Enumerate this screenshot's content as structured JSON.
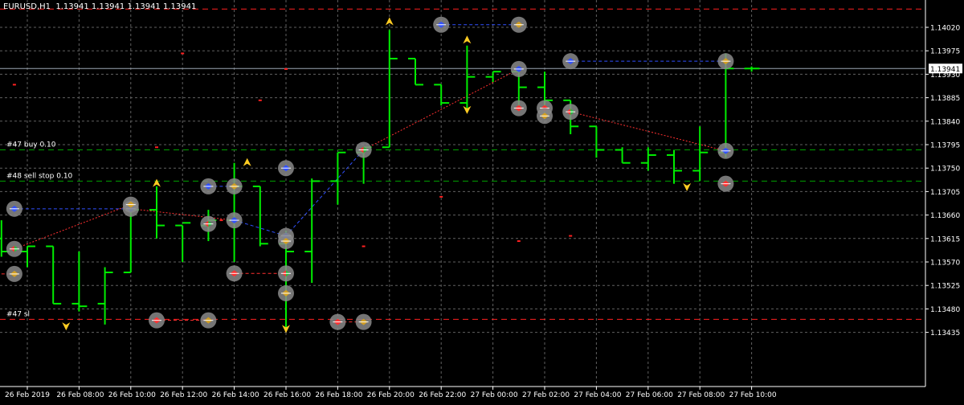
{
  "window": {
    "symbol": "EURUSD,H1",
    "ohlc": "1.13941 1.13941 1.13941 1.13941"
  },
  "colors": {
    "background": "#000000",
    "grid": "#606060",
    "candle": "#00ee00",
    "axis_text": "#ffffff",
    "price_label_bg": "#ffffff",
    "price_label_text": "#000000",
    "bid_line": "#9aa6b3",
    "buy_line": "#00a000",
    "sell_stop_line": "#00a000",
    "sl_line": "#ff2020",
    "trade_buy": "#3050ff",
    "trade_sell": "#ff3030",
    "fractal": "#ffcc22"
  },
  "chart_data": {
    "type": "bar",
    "symbol": "EURUSD",
    "timeframe": "H1",
    "ylim": [
      1.1341,
      1.1406
    ],
    "y_ticks": [
      "1.14020",
      "1.13975",
      "1.13930",
      "1.13885",
      "1.13840",
      "1.13795",
      "1.13750",
      "1.13705",
      "1.13660",
      "1.13615",
      "1.13570",
      "1.13525",
      "1.13480",
      "1.13435"
    ],
    "x_ticks": [
      {
        "i": 0,
        "label": "26 Feb 2019"
      },
      {
        "i": 2,
        "label": "26 Feb 08:00"
      },
      {
        "i": 4,
        "label": "26 Feb 10:00"
      },
      {
        "i": 6,
        "label": "26 Feb 12:00"
      },
      {
        "i": 8,
        "label": "26 Feb 14:00"
      },
      {
        "i": 10,
        "label": "26 Feb 16:00"
      },
      {
        "i": 12,
        "label": "26 Feb 18:00"
      },
      {
        "i": 14,
        "label": "26 Feb 20:00"
      },
      {
        "i": 16,
        "label": "26 Feb 22:00"
      },
      {
        "i": 18,
        "label": "27 Feb 00:00"
      },
      {
        "i": 20,
        "label": "27 Feb 02:00"
      },
      {
        "i": 22,
        "label": "27 Feb 04:00"
      },
      {
        "i": 24,
        "label": "27 Feb 06:00"
      },
      {
        "i": 26,
        "label": "27 Feb 08:00"
      },
      {
        "i": 28,
        "label": "27 Feb 10:00"
      }
    ],
    "bars": [
      {
        "i": -1,
        "o": 1.13615,
        "h": 1.1365,
        "l": 1.1358,
        "c": 1.1359
      },
      {
        "i": 0,
        "o": 1.1359,
        "h": 1.136,
        "l": 1.1356,
        "c": 1.136
      },
      {
        "i": 1,
        "o": 1.136,
        "h": 1.136,
        "l": 1.1349,
        "c": 1.1349
      },
      {
        "i": 2,
        "o": 1.1349,
        "h": 1.1359,
        "l": 1.13475,
        "c": 1.13485
      },
      {
        "i": 3,
        "o": 1.1349,
        "h": 1.1356,
        "l": 1.1345,
        "c": 1.1355
      },
      {
        "i": 4,
        "o": 1.1355,
        "h": 1.1368,
        "l": 1.1355,
        "c": 1.1367
      },
      {
        "i": 5,
        "o": 1.1367,
        "h": 1.13715,
        "l": 1.13615,
        "c": 1.1364
      },
      {
        "i": 6,
        "o": 1.1364,
        "h": 1.1364,
        "l": 1.1357,
        "c": 1.13645
      },
      {
        "i": 7,
        "o": 1.1364,
        "h": 1.1367,
        "l": 1.1361,
        "c": 1.1365
      },
      {
        "i": 8,
        "o": 1.1365,
        "h": 1.1376,
        "l": 1.1357,
        "c": 1.13715
      },
      {
        "i": 9,
        "o": 1.13715,
        "h": 1.13715,
        "l": 1.136,
        "c": 1.13605
      },
      {
        "i": 10,
        "o": 1.13605,
        "h": 1.1363,
        "l": 1.1344,
        "c": 1.1359
      },
      {
        "i": 11,
        "o": 1.1359,
        "h": 1.1373,
        "l": 1.1353,
        "c": 1.13725
      },
      {
        "i": 12,
        "o": 1.13725,
        "h": 1.1378,
        "l": 1.1368,
        "c": 1.1378
      },
      {
        "i": 13,
        "o": 1.1378,
        "h": 1.1379,
        "l": 1.1372,
        "c": 1.1379
      },
      {
        "i": 14,
        "o": 1.1379,
        "h": 1.14015,
        "l": 1.1379,
        "c": 1.1396
      },
      {
        "i": 15,
        "o": 1.1396,
        "h": 1.1396,
        "l": 1.1391,
        "c": 1.1391
      },
      {
        "i": 16,
        "o": 1.1391,
        "h": 1.1391,
        "l": 1.1387,
        "c": 1.13875
      },
      {
        "i": 17,
        "o": 1.13875,
        "h": 1.13985,
        "l": 1.13865,
        "c": 1.13925
      },
      {
        "i": 18,
        "o": 1.13925,
        "h": 1.13935,
        "l": 1.13915,
        "c": 1.13935
      },
      {
        "i": 19,
        "o": 1.13935,
        "h": 1.1394,
        "l": 1.1386,
        "c": 1.13905
      },
      {
        "i": 20,
        "o": 1.13905,
        "h": 1.13935,
        "l": 1.13855,
        "c": 1.1388
      },
      {
        "i": 21,
        "o": 1.1388,
        "h": 1.1388,
        "l": 1.13815,
        "c": 1.1383
      },
      {
        "i": 22,
        "o": 1.1383,
        "h": 1.1383,
        "l": 1.1377,
        "c": 1.13785
      },
      {
        "i": 23,
        "o": 1.13785,
        "h": 1.1379,
        "l": 1.1376,
        "c": 1.1376
      },
      {
        "i": 24,
        "o": 1.1376,
        "h": 1.1379,
        "l": 1.13745,
        "c": 1.13775
      },
      {
        "i": 25,
        "o": 1.13775,
        "h": 1.13785,
        "l": 1.1372,
        "c": 1.13745
      },
      {
        "i": 26,
        "o": 1.13745,
        "h": 1.1383,
        "l": 1.13725,
        "c": 1.1378
      },
      {
        "i": 27,
        "o": 1.1378,
        "h": 1.1397,
        "l": 1.1377,
        "c": 1.13941
      },
      {
        "i": 28,
        "o": 1.13941,
        "h": 1.13945,
        "l": 1.13935,
        "c": 1.13941
      }
    ],
    "levels": [
      {
        "name": "bid",
        "price": 1.13941,
        "style": "solid",
        "color": "bid_line",
        "label": ""
      },
      {
        "name": "buy",
        "price": 1.13785,
        "style": "dash",
        "color": "buy_line",
        "label": "#47 buy 0.10"
      },
      {
        "name": "sell_stop",
        "price": 1.13725,
        "style": "dash",
        "color": "sell_stop_line",
        "label": "#48 sell stop 0.10"
      },
      {
        "name": "sl",
        "price": 1.1346,
        "style": "dash",
        "color": "sl_line",
        "label": "#47 sl"
      },
      {
        "name": "top",
        "price": 1.14055,
        "style": "dash",
        "color": "sl_line",
        "label": ""
      }
    ],
    "current_price_label": "1.13941",
    "fractals": [
      {
        "i": 1.5,
        "price": 1.13448,
        "dir": "down"
      },
      {
        "i": 5,
        "price": 1.1372,
        "dir": "up"
      },
      {
        "i": 8.5,
        "price": 1.1376,
        "dir": "up"
      },
      {
        "i": 10,
        "price": 1.13443,
        "dir": "down"
      },
      {
        "i": 14,
        "price": 1.1403,
        "dir": "up"
      },
      {
        "i": 17,
        "price": 1.13995,
        "dir": "up"
      },
      {
        "i": 17,
        "price": 1.13863,
        "dir": "down"
      },
      {
        "i": 25.5,
        "price": 1.13715,
        "dir": "down"
      }
    ],
    "trade_arrows": [
      {
        "i": -0.5,
        "price": 1.13672,
        "kind": "buy"
      },
      {
        "i": -0.5,
        "price": 1.13595,
        "kind": "mixed"
      },
      {
        "i": -0.5,
        "price": 1.13547,
        "kind": "close"
      },
      {
        "i": 4,
        "price": 1.13672,
        "kind": "buy"
      },
      {
        "i": 4,
        "price": 1.1368,
        "kind": "close"
      },
      {
        "i": 5,
        "price": 1.13458,
        "kind": "sell"
      },
      {
        "i": 7,
        "price": 1.13458,
        "kind": "close"
      },
      {
        "i": 7,
        "price": 1.13715,
        "kind": "buy"
      },
      {
        "i": 7,
        "price": 1.13643,
        "kind": "mixed"
      },
      {
        "i": 8,
        "price": 1.13715,
        "kind": "close"
      },
      {
        "i": 8,
        "price": 1.1365,
        "kind": "buy"
      },
      {
        "i": 8,
        "price": 1.13548,
        "kind": "sell"
      },
      {
        "i": 10,
        "price": 1.1375,
        "kind": "buy"
      },
      {
        "i": 10,
        "price": 1.13548,
        "kind": "mixed"
      },
      {
        "i": 10,
        "price": 1.1362,
        "kind": "buy"
      },
      {
        "i": 10,
        "price": 1.1361,
        "kind": "close"
      },
      {
        "i": 10,
        "price": 1.1351,
        "kind": "close"
      },
      {
        "i": 12,
        "price": 1.13455,
        "kind": "sell"
      },
      {
        "i": 13,
        "price": 1.13455,
        "kind": "close"
      },
      {
        "i": 13,
        "price": 1.13785,
        "kind": "mixed"
      },
      {
        "i": 16,
        "price": 1.14025,
        "kind": "buy"
      },
      {
        "i": 19,
        "price": 1.14025,
        "kind": "close"
      },
      {
        "i": 19,
        "price": 1.1394,
        "kind": "buy"
      },
      {
        "i": 19,
        "price": 1.13865,
        "kind": "sell"
      },
      {
        "i": 20,
        "price": 1.13865,
        "kind": "sell"
      },
      {
        "i": 20,
        "price": 1.1385,
        "kind": "close"
      },
      {
        "i": 21,
        "price": 1.13858,
        "kind": "mixed"
      },
      {
        "i": 21,
        "price": 1.13955,
        "kind": "buy"
      },
      {
        "i": 27,
        "price": 1.13955,
        "kind": "close"
      },
      {
        "i": 27,
        "price": 1.13783,
        "kind": "buy"
      },
      {
        "i": 27,
        "price": 1.1372,
        "kind": "sell"
      }
    ],
    "trade_lines": [
      {
        "i1": -0.5,
        "p1": 1.13672,
        "i2": 4,
        "p2": 1.13672,
        "color": "trade_buy",
        "style": "dash"
      },
      {
        "i1": -0.5,
        "p1": 1.13595,
        "i2": 4,
        "p2": 1.1368,
        "color": "trade_sell",
        "style": "dot"
      },
      {
        "i1": -1,
        "p1": 1.13547,
        "i2": -0.5,
        "p2": 1.13547,
        "color": "trade_sell",
        "style": "dash"
      },
      {
        "i1": 4,
        "p1": 1.13672,
        "i2": 8,
        "p2": 1.1365,
        "color": "trade_sell",
        "style": "dot"
      },
      {
        "i1": 5,
        "p1": 1.13458,
        "i2": 7,
        "p2": 1.13458,
        "color": "trade_sell",
        "style": "dash"
      },
      {
        "i1": 7,
        "p1": 1.13715,
        "i2": 8,
        "p2": 1.13715,
        "color": "trade_buy",
        "style": "dash"
      },
      {
        "i1": 8,
        "p1": 1.1365,
        "i2": 10,
        "p2": 1.1362,
        "color": "trade_buy",
        "style": "dash"
      },
      {
        "i1": 8,
        "p1": 1.13548,
        "i2": 10,
        "p2": 1.13548,
        "color": "trade_sell",
        "style": "dash"
      },
      {
        "i1": 10,
        "p1": 1.1362,
        "i2": 13,
        "p2": 1.13785,
        "color": "trade_buy",
        "style": "dash"
      },
      {
        "i1": 12,
        "p1": 1.13455,
        "i2": 13,
        "p2": 1.13455,
        "color": "trade_sell",
        "style": "dash"
      },
      {
        "i1": 13,
        "p1": 1.13785,
        "i2": 19,
        "p2": 1.1394,
        "color": "trade_sell",
        "style": "dot"
      },
      {
        "i1": 16,
        "p1": 1.14025,
        "i2": 19,
        "p2": 1.14025,
        "color": "trade_buy",
        "style": "dash"
      },
      {
        "i1": 21,
        "p1": 1.13955,
        "i2": 27,
        "p2": 1.13955,
        "color": "trade_buy",
        "style": "dash"
      },
      {
        "i1": 21,
        "p1": 1.13858,
        "i2": 27,
        "p2": 1.13783,
        "color": "trade_sell",
        "style": "dot"
      }
    ],
    "small_marks": [
      {
        "i": -0.5,
        "price": 1.1391
      },
      {
        "i": 5,
        "price": 1.1379
      },
      {
        "i": 6,
        "price": 1.1397
      },
      {
        "i": 7.5,
        "price": 1.1365
      },
      {
        "i": 9,
        "price": 1.1388
      },
      {
        "i": 10,
        "price": 1.1394
      },
      {
        "i": 13,
        "price": 1.136
      },
      {
        "i": 16,
        "price": 1.13695
      },
      {
        "i": 19,
        "price": 1.1361
      },
      {
        "i": 21,
        "price": 1.1362
      }
    ]
  }
}
